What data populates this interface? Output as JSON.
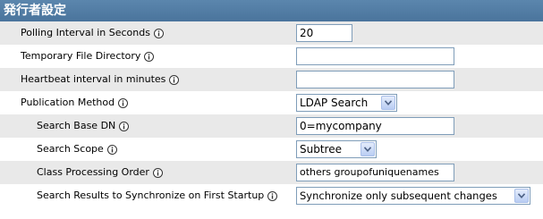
{
  "section": {
    "title": "発行者設定"
  },
  "rows": [
    {
      "label": "Polling Interval in Seconds",
      "control": "text",
      "value": "20"
    },
    {
      "label": "Temporary File Directory",
      "control": "text",
      "value": ""
    },
    {
      "label": "Heartbeat interval in minutes",
      "control": "text",
      "value": ""
    },
    {
      "label": "Publication Method",
      "control": "select",
      "value": "LDAP Search"
    },
    {
      "label": "Search Base DN",
      "control": "text",
      "value": "0=mycompany"
    },
    {
      "label": "Search Scope",
      "control": "select",
      "value": "Subtree"
    },
    {
      "label": "Class Processing Order",
      "control": "text",
      "value": "others groupofuniquenames"
    },
    {
      "label": "Search Results to Synchronize on First Startup",
      "control": "select",
      "value": "Synchronize only subsequent changes"
    }
  ],
  "icons": {
    "info": "info-icon"
  },
  "colors": {
    "header_bg": "#4f7aa3",
    "row_alt": "#e9e9e9",
    "field_border": "#7f9db9"
  }
}
